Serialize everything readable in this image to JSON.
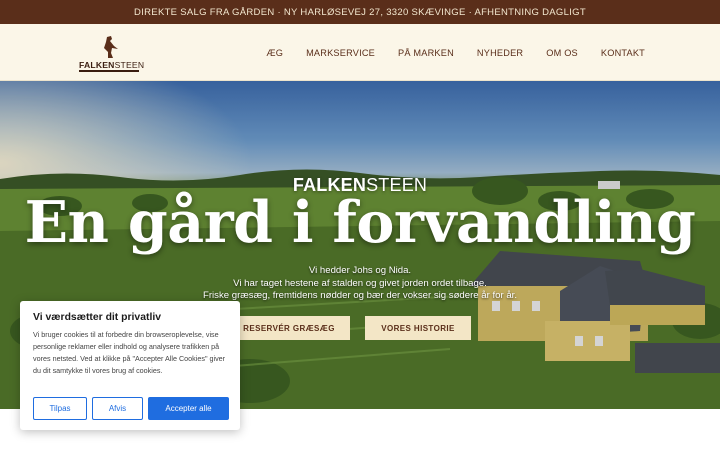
{
  "topbar": {
    "text": "DIREKTE SALG FRA GÅRDEN · NY HARLØSEVEJ 27, 3320 SKÆVINGE · AFHENTNING DAGLIGT"
  },
  "logo": {
    "bold": "FALKEN",
    "light": "STEEN",
    "icon": "falcon-icon"
  },
  "nav": {
    "items": [
      {
        "label": "ÆG"
      },
      {
        "label": "MARKSERVICE"
      },
      {
        "label": "PÅ MARKEN"
      },
      {
        "label": "NYHEDER"
      },
      {
        "label": "OM OS"
      },
      {
        "label": "KONTAKT"
      }
    ]
  },
  "hero": {
    "brand_bold": "FALKEN",
    "brand_light": "STEEN",
    "title": "En gård i forvandling",
    "subtitle": [
      "Vi hedder Johs og Nida.",
      "Vi har taget hestene af stalden og givet jorden ordet tilbage.",
      "Friske græsæg, fremtidens nødder og bær der vokser sig sødere år for år."
    ],
    "buttons": {
      "primary": "RESERVÉR GRÆSÆG",
      "secondary": "VORES HISTORIE"
    }
  },
  "cookie": {
    "title": "Vi værdsætter dit privatliv",
    "text": "Vi bruger cookies til at forbedre din browseroplevelse, vise personlige reklamer eller indhold og analysere trafikken på vores netsted. Ved at klikke på \"Accepter Alle Cookies\" giver du dit samtykke til vores brug af cookies.",
    "buttons": {
      "customize": "Tilpas",
      "reject": "Afvis",
      "accept": "Accepter alle"
    }
  },
  "colors": {
    "topbar": "#5a2e1a",
    "header": "#fbf6e8",
    "button": "#f3e6c6",
    "accent_blue": "#1f6de0"
  }
}
